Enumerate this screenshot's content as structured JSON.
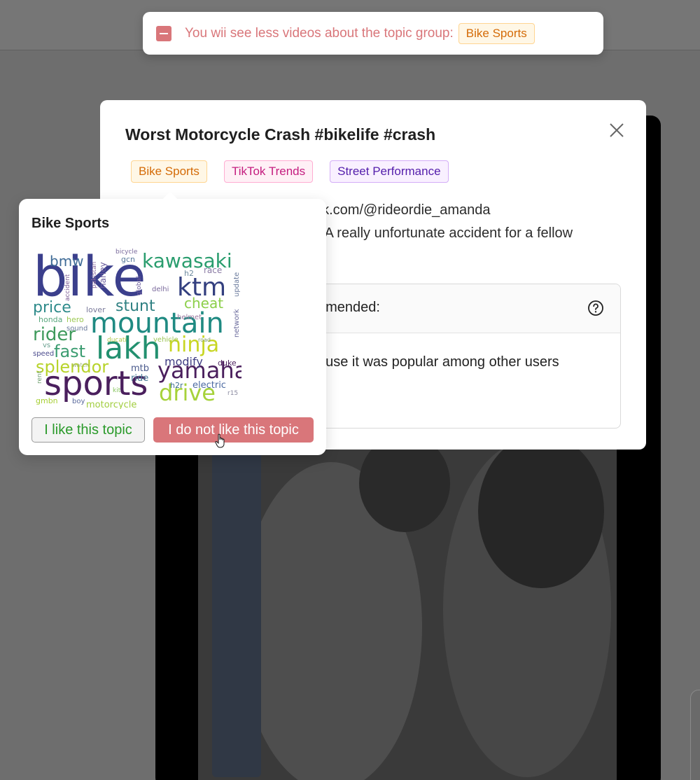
{
  "toast": {
    "icon": "minus-square-icon",
    "message": "You wii see less videos about the topic group:",
    "topic_tag": "Bike Sports"
  },
  "modal": {
    "title": "Worst Motorcycle Crash #bikelife #crash",
    "close_icon": "close-icon",
    "tags": [
      "Bike Sports",
      "TikTok Trends",
      "Street Performance"
    ],
    "source_fragment": "ok.com/@rideordie_amanda",
    "description_fragment": "s A really unfortunate accident for a fellow",
    "reason_header_fragment": "nmended:",
    "help_icon": "question-circle-icon",
    "reason_text_fragment": "ause it was popular among other users"
  },
  "popover": {
    "title": "Bike Sports",
    "like_label": "I like this topic",
    "dislike_label": "I do not like this topic",
    "wordcloud_words": [
      "bike",
      "sports",
      "mountain",
      "lakh",
      "ktm",
      "kawasaki",
      "yamaha",
      "ninja",
      "drive",
      "splendor",
      "rider",
      "price",
      "fast",
      "stunt",
      "cheat",
      "modify",
      "bmw",
      "mtb",
      "electric",
      "duke",
      "h2r",
      "motorcycle",
      "honda",
      "hero",
      "sound",
      "speed",
      "vs",
      "kit",
      "rent",
      "gmbn",
      "boy",
      "ride",
      "vehicle",
      "road",
      "ducati",
      "watch",
      "lover",
      "helmet",
      "delhi",
      "global",
      "race",
      "h2",
      "gcn",
      "bicycle",
      "harley",
      "pakistan",
      "accident",
      "update",
      "network",
      "r15"
    ]
  },
  "colors": {
    "accent_red": "#d9767a",
    "like_green": "#2a9a2a",
    "tag_orange": "#d46b08",
    "tag_pink": "#c41d7f",
    "tag_purple": "#531dab"
  }
}
